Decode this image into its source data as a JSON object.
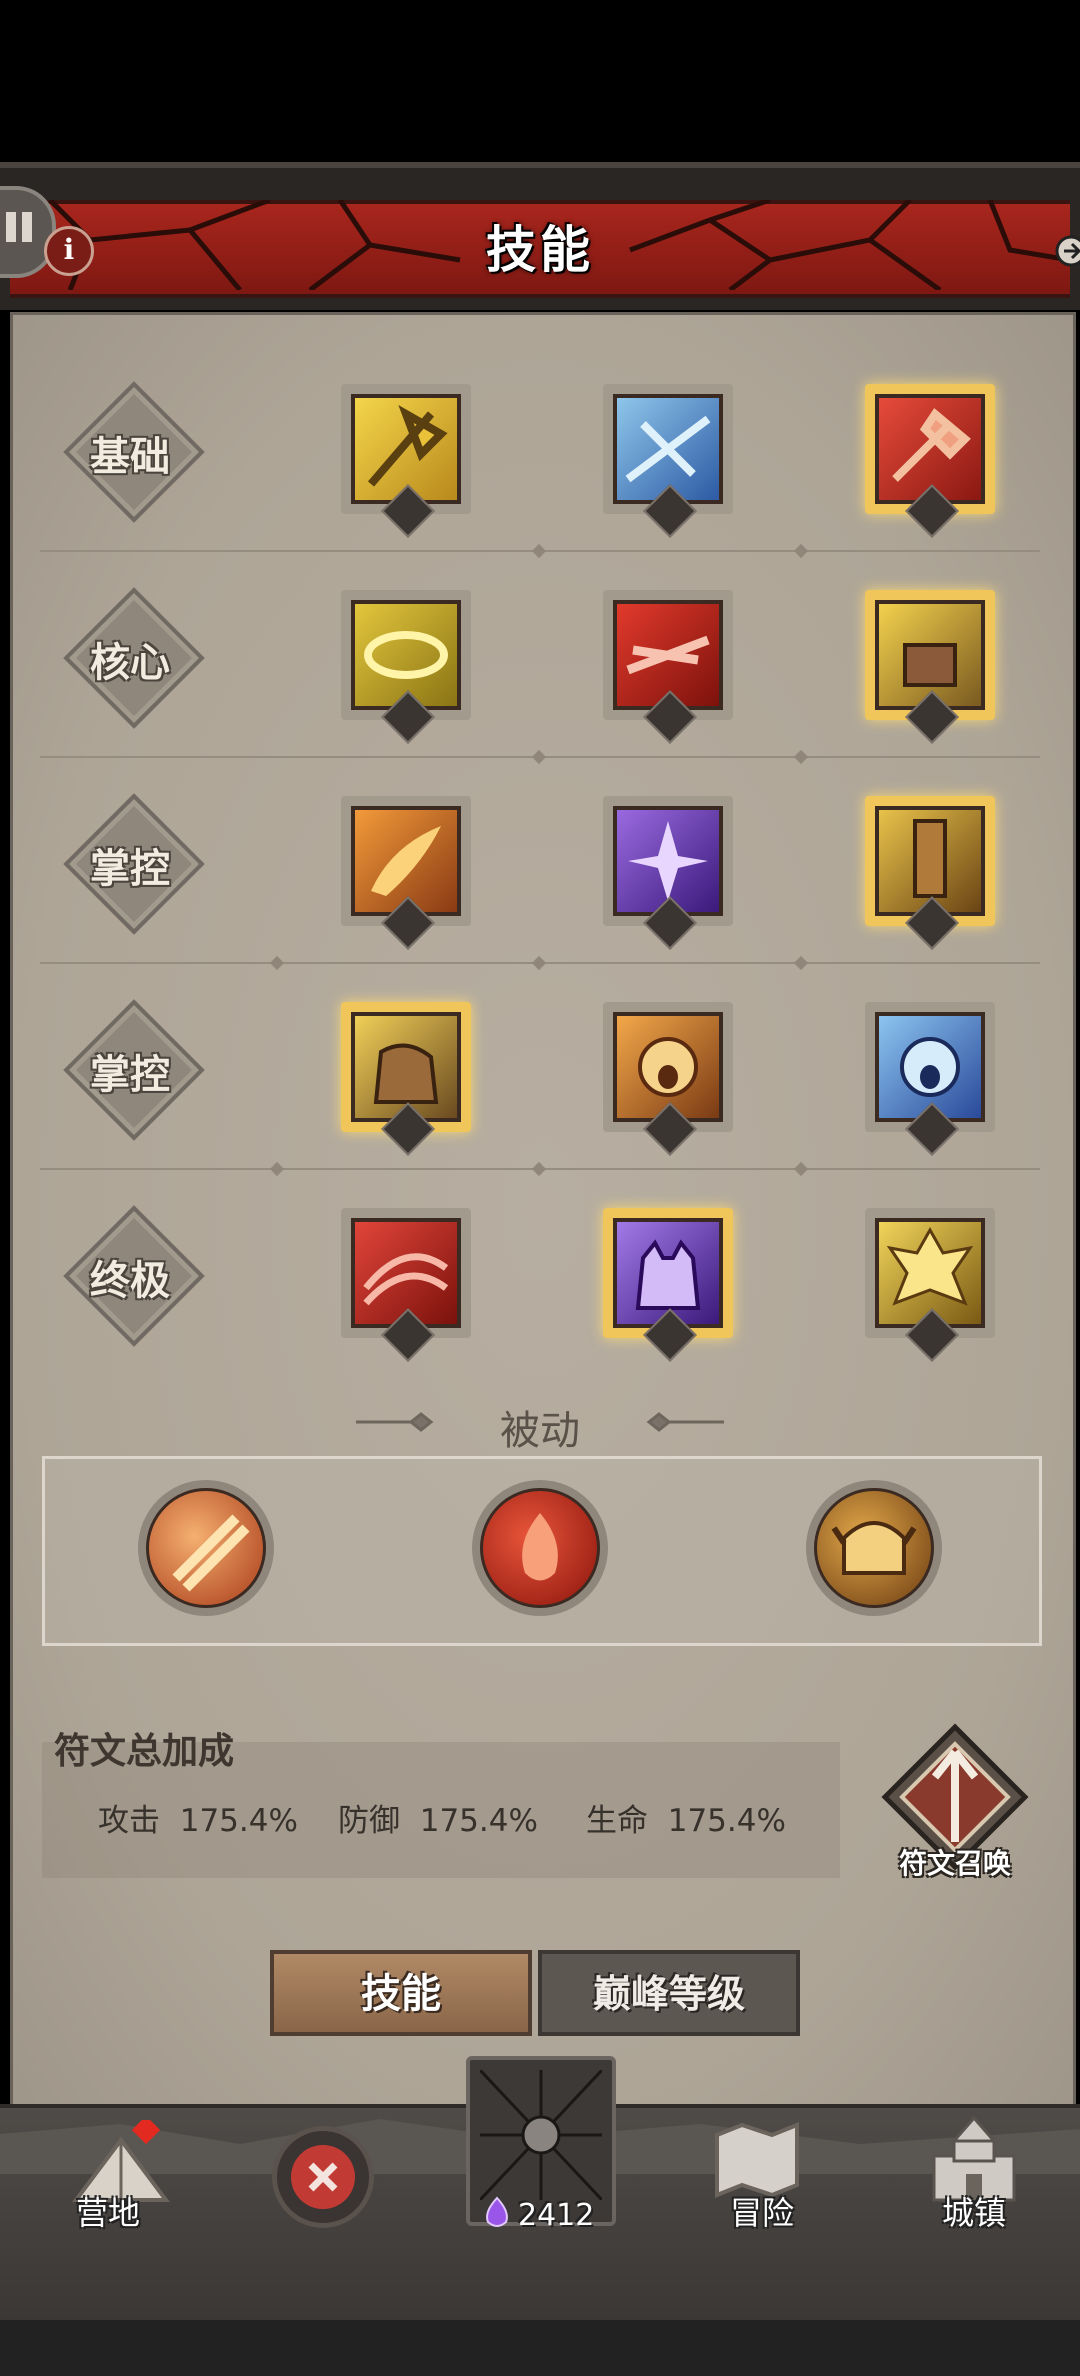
{
  "header": {
    "title": "技能"
  },
  "skill_rows": [
    {
      "label": "基础"
    },
    {
      "label": "核心"
    },
    {
      "label": "掌控"
    },
    {
      "label": "掌控"
    },
    {
      "label": "终极"
    }
  ],
  "passive": {
    "title": "被动"
  },
  "rune_bonus": {
    "title": "符文总加成",
    "stats": [
      {
        "name": "攻击",
        "value": "175.4%"
      },
      {
        "name": "防御",
        "value": "175.4%"
      },
      {
        "name": "生命",
        "value": "175.4%"
      }
    ],
    "summon_label": "符文召唤"
  },
  "tabs": {
    "skill": "技能",
    "peak_level": "巅峰等级"
  },
  "bottom_nav": {
    "camp": "营地",
    "adventure": "冒险",
    "town": "城镇",
    "currency_value": "2412"
  },
  "colors": {
    "banner_red": "#9a2219",
    "parchment": "#b1a89b",
    "selected_gold": "#f0c55a"
  }
}
